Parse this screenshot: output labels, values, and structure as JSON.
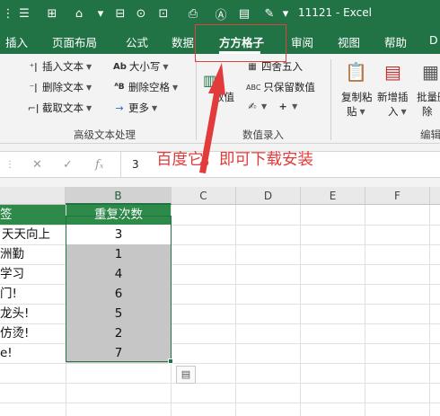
{
  "titlebar": {
    "title": "11121  -  Excel",
    "quick_access": [
      "⋮",
      "☰",
      "⊞",
      "⌂",
      "▾",
      "⊟",
      "⊙",
      "⊡",
      "⎙",
      "Ⓐ",
      "▤",
      "✎",
      "▾"
    ]
  },
  "tabs": [
    "插入",
    "页面布局",
    "公式",
    "数据",
    "方方格子",
    "审阅",
    "视图",
    "帮助",
    "D"
  ],
  "active_tab": "方方格子",
  "ribbon": {
    "text_group": {
      "items": [
        "插入文本",
        "删除文本",
        "截取文本"
      ],
      "items2": [
        "大小写",
        "删除空格",
        "更多"
      ],
      "label": "高级文本处理"
    },
    "number_group": {
      "numvalue": "数值",
      "items": [
        "四舍五入",
        "只保留数值"
      ],
      "label": "数值录入"
    },
    "edit_group": {
      "copy_paste": [
        "复制粘",
        "贴"
      ],
      "insert_new": [
        "新增插",
        "入"
      ],
      "batch_delete": [
        "批量删",
        "除"
      ],
      "label": "编辑"
    }
  },
  "formula_bar": {
    "value": "3",
    "icons": [
      "cancel-icon",
      "enter-icon",
      "fx-icon"
    ]
  },
  "annotation": {
    "text": "百度它，即可下载安装",
    "color": "#e23b3b"
  },
  "sheet": {
    "columns": [
      "B",
      "C",
      "D",
      "E",
      "F"
    ],
    "selected_column": "B",
    "header_row": {
      "a": "签",
      "b": "重复次数"
    },
    "rows": [
      {
        "a": "天天向上",
        "b": "3"
      },
      {
        "a": "洲勤",
        "b": "1"
      },
      {
        "a": "学习",
        "b": "4"
      },
      {
        "a": "门!",
        "b": "6"
      },
      {
        "a": "龙头!",
        "b": "5"
      },
      {
        "a": "仿烫!",
        "b": "2"
      },
      {
        "a": "e!",
        "b": "7"
      }
    ]
  },
  "colors": {
    "accent": "#217346",
    "header_fill": "#2e8a49",
    "selected_fill": "#c6c6c6"
  }
}
